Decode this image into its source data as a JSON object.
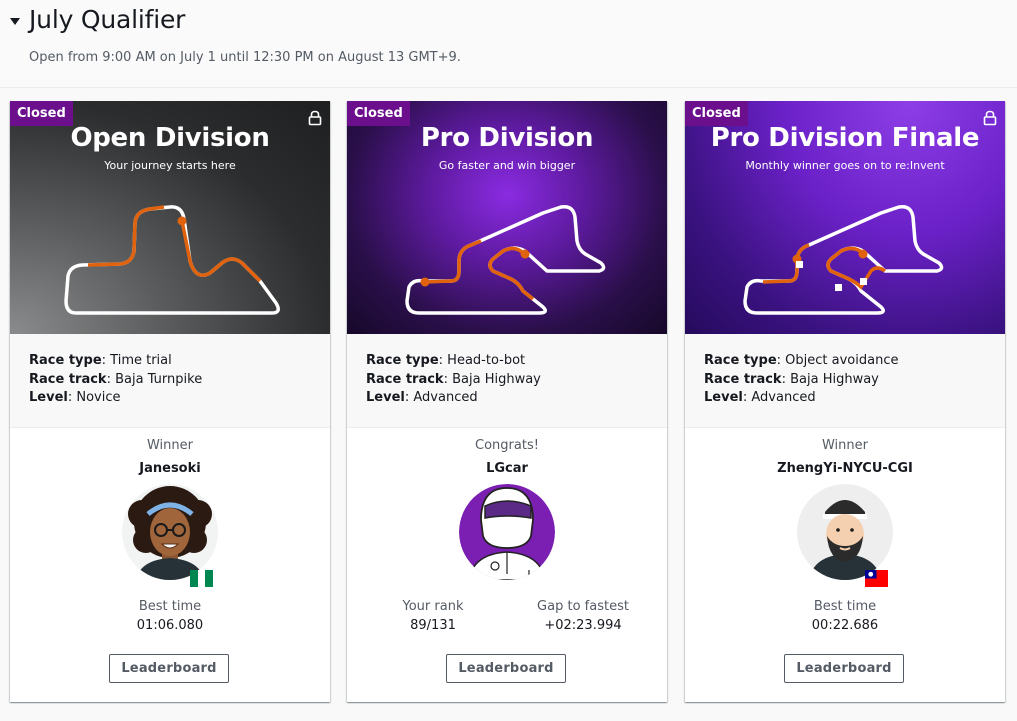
{
  "section": {
    "title": "July Qualifier",
    "subtitle": "Open from 9:00 AM on July 1 until 12:30 PM on August 13 GMT+9."
  },
  "cards": [
    {
      "badge": "Closed",
      "name": "Open Division",
      "tagline": "Your journey starts here",
      "locked": true,
      "race_type_label": "Race type",
      "race_type": "Time trial",
      "race_track_label": "Race track",
      "race_track": "Baja Turnpike",
      "level_label": "Level",
      "level": "Novice",
      "winner_label": "Winner",
      "winner_name": "Janesoki",
      "flag": "nigeria",
      "stat1_label": "Best time",
      "stat1_value": "01:06.080",
      "button": "Leaderboard"
    },
    {
      "badge": "Closed",
      "name": "Pro Division",
      "tagline": "Go faster and win bigger",
      "locked": false,
      "race_type_label": "Race type",
      "race_type": "Head-to-bot",
      "race_track_label": "Race track",
      "race_track": "Baja Highway",
      "level_label": "Level",
      "level": "Advanced",
      "winner_label": "Congrats!",
      "winner_name": "LGcar",
      "stat1_label": "Your rank",
      "stat1_value": "89/131",
      "stat2_label": "Gap to fastest",
      "stat2_value": "+02:23.994",
      "button": "Leaderboard"
    },
    {
      "badge": "Closed",
      "name": "Pro Division Finale",
      "tagline": "Monthly winner goes on to re:Invent",
      "locked": true,
      "race_type_label": "Race type",
      "race_type": "Object avoidance",
      "race_track_label": "Race track",
      "race_track": "Baja Highway",
      "level_label": "Level",
      "level": "Advanced",
      "winner_label": "Winner",
      "winner_name": "ZhengYi-NYCU-CGI",
      "flag": "taiwan",
      "stat1_label": "Best time",
      "stat1_value": "00:22.686",
      "button": "Leaderboard"
    }
  ],
  "colors": {
    "badge": "#6b0f8c",
    "track_line": "#ffffff",
    "track_path": "#e0620d",
    "pro_avatar_bg": "#7b1fb3"
  },
  "icons": {
    "lock": "lock-icon",
    "toggle": "caret-down-icon"
  }
}
